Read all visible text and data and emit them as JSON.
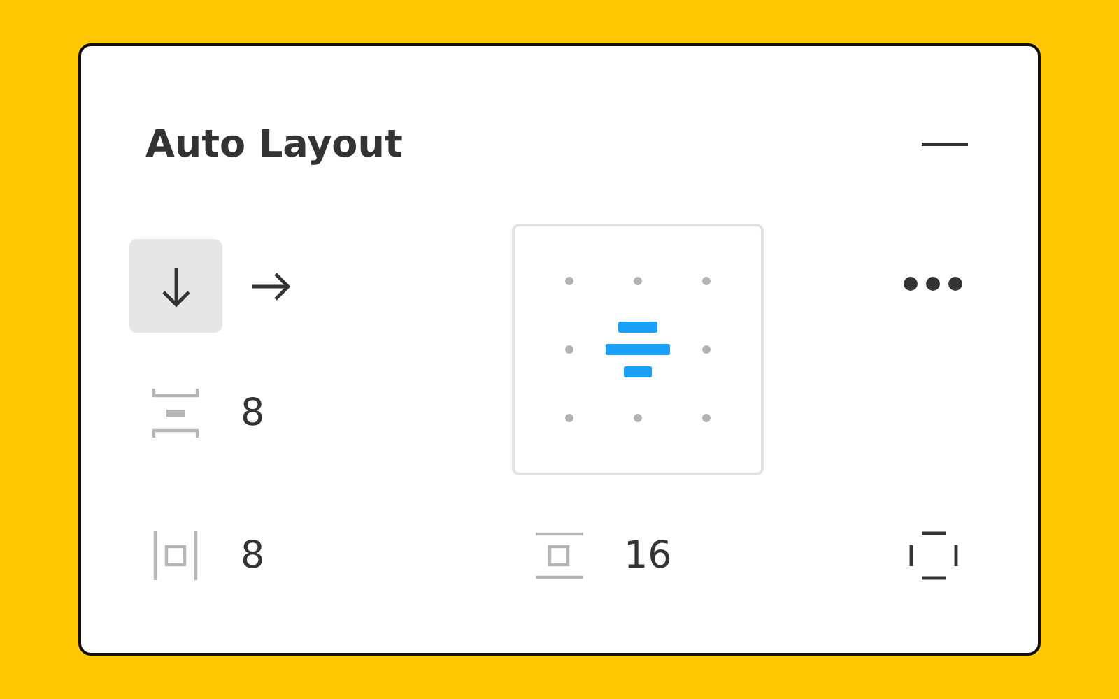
{
  "panel": {
    "title": "Auto Layout"
  },
  "direction": [
    {
      "kind": "vertical",
      "selected": true
    },
    {
      "kind": "horizontal",
      "selected": false
    }
  ],
  "spacing": {
    "value": "8"
  },
  "alignment": [
    {
      "selected": false
    },
    {
      "selected": false
    },
    {
      "selected": false
    },
    {
      "selected": false
    },
    {
      "selected": true
    },
    {
      "selected": false
    },
    {
      "selected": false
    },
    {
      "selected": false
    },
    {
      "selected": false
    }
  ],
  "padding_horizontal": {
    "value": "8"
  },
  "padding_vertical": {
    "value": "16"
  }
}
